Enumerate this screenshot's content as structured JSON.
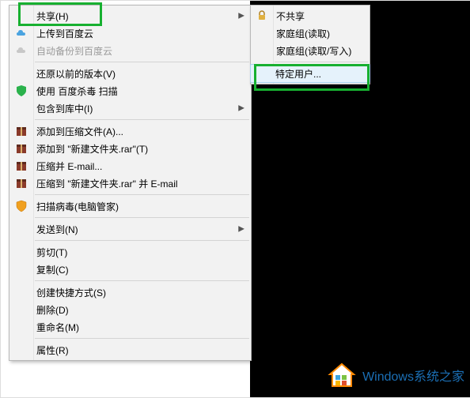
{
  "menu": {
    "share": {
      "label": "共享(H)"
    },
    "upload": {
      "label": "上传到百度云"
    },
    "autobackup": {
      "label": "自动备份到百度云"
    },
    "restore": {
      "label": "还原以前的版本(V)"
    },
    "scan_baidu": {
      "label": "使用 百度杀毒 扫描"
    },
    "include_lib": {
      "label": "包含到库中(I)"
    },
    "add_archive": {
      "label": "添加到压缩文件(A)..."
    },
    "add_rar": {
      "label": "添加到 \"新建文件夹.rar\"(T)"
    },
    "zip_email": {
      "label": "压缩并 E-mail..."
    },
    "zip_rar_email": {
      "label": "压缩到 \"新建文件夹.rar\" 并 E-mail"
    },
    "scan_tencent": {
      "label": "扫描病毒(电脑管家)"
    },
    "send_to": {
      "label": "发送到(N)"
    },
    "cut": {
      "label": "剪切(T)"
    },
    "copy": {
      "label": "复制(C)"
    },
    "shortcut": {
      "label": "创建快捷方式(S)"
    },
    "delete": {
      "label": "删除(D)"
    },
    "rename": {
      "label": "重命名(M)"
    },
    "properties": {
      "label": "属性(R)"
    }
  },
  "submenu": {
    "no_share": {
      "label": "不共享"
    },
    "hg_read": {
      "label": "家庭组(读取)"
    },
    "hg_rw": {
      "label": "家庭组(读取/写入)"
    },
    "specific": {
      "label": "特定用户..."
    }
  },
  "watermark": {
    "text": "Windows系统之家"
  }
}
